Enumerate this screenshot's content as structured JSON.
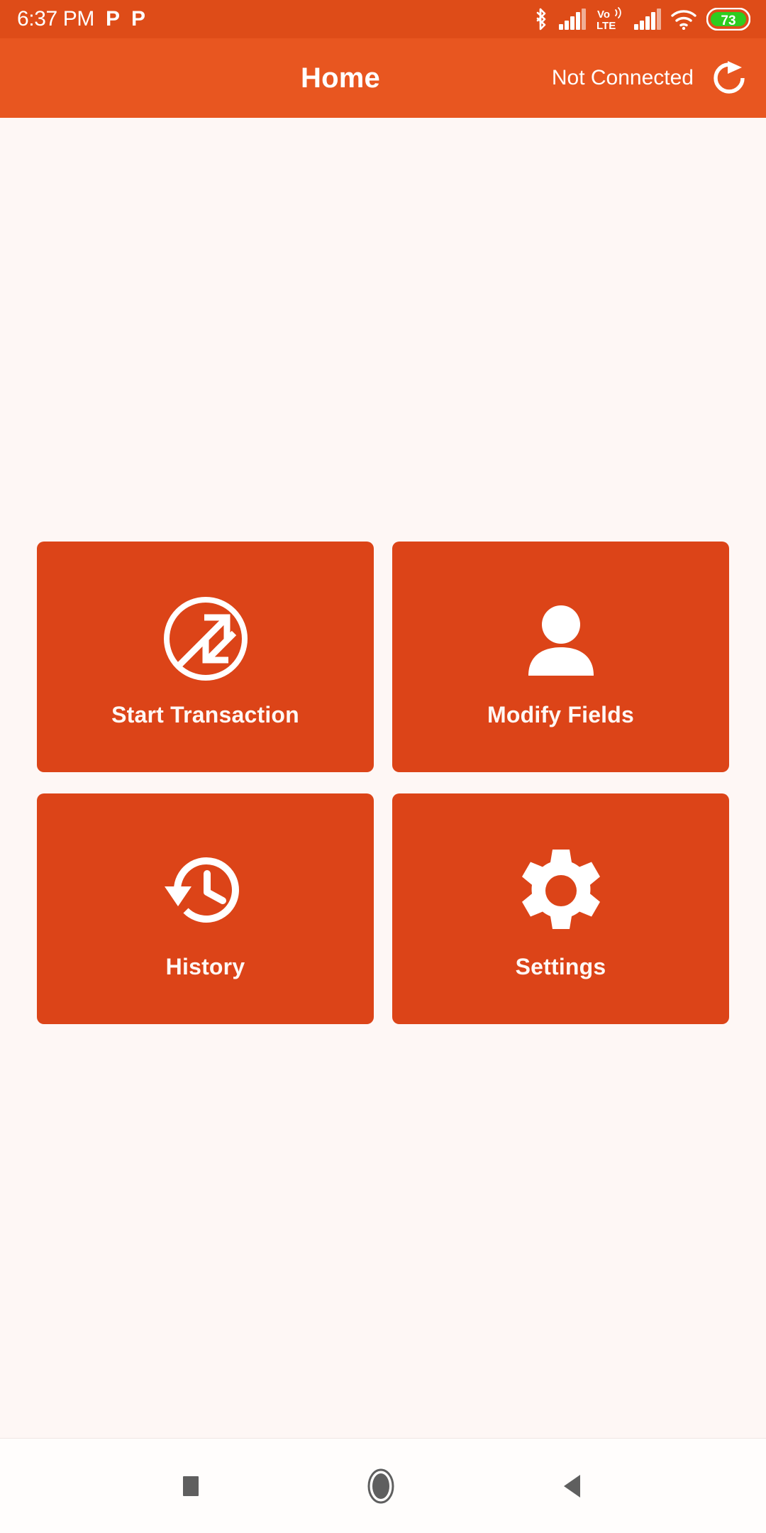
{
  "status_bar": {
    "time": "6:37 PM",
    "notification_glyphs": [
      "P",
      "P"
    ],
    "icons": [
      {
        "name": "bluetooth-icon"
      },
      {
        "name": "signal-sim1-icon"
      },
      {
        "name": "volte-icon",
        "label_top": "Vo",
        "label_bottom": "LTE"
      },
      {
        "name": "signal-sim2-icon"
      },
      {
        "name": "wifi-icon"
      },
      {
        "name": "battery-icon",
        "level": "73"
      }
    ],
    "background": "#DE4C18",
    "battery_fill": "#2ECC1F"
  },
  "app_bar": {
    "title": "Home",
    "connection_status": "Not Connected",
    "refresh_icon": "refresh-icon",
    "background": "#E85620"
  },
  "grid": {
    "cards": [
      {
        "id": "start-transaction",
        "label": "Start Transaction",
        "icon": "transaction-arrows-icon"
      },
      {
        "id": "modify-fields",
        "label": "Modify Fields",
        "icon": "person-icon"
      },
      {
        "id": "history",
        "label": "History",
        "icon": "history-clock-icon"
      },
      {
        "id": "settings",
        "label": "Settings",
        "icon": "gear-icon"
      }
    ],
    "card_color": "#DC4418",
    "label_color": "#FFF8F5"
  },
  "page": {
    "background": "#FEF7F5"
  },
  "nav_bar": {
    "buttons": [
      {
        "id": "recents",
        "icon": "square-recents-icon"
      },
      {
        "id": "home",
        "icon": "circle-home-icon"
      },
      {
        "id": "back",
        "icon": "triangle-back-icon"
      }
    ],
    "icon_color": "#5F5F5F"
  }
}
